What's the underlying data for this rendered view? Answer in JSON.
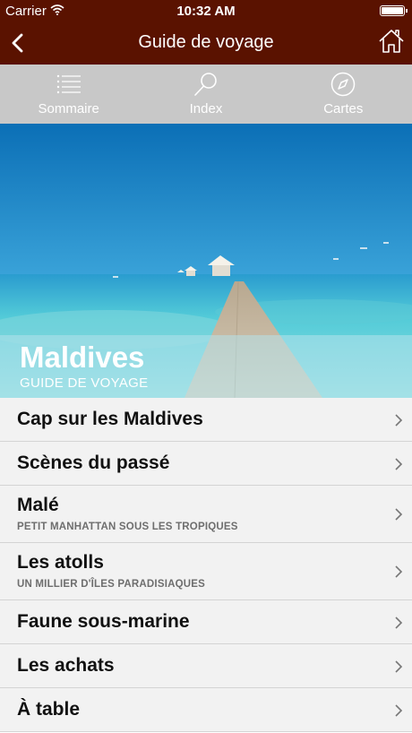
{
  "status_bar": {
    "carrier": "Carrier",
    "time": "10:32 AM"
  },
  "nav": {
    "title": "Guide de voyage",
    "back_icon": "chevron-left-icon",
    "home_icon": "home-icon"
  },
  "tabs": [
    {
      "label": "Sommaire",
      "icon": "list-icon"
    },
    {
      "label": "Index",
      "icon": "search-icon"
    },
    {
      "label": "Cartes",
      "icon": "compass-icon"
    }
  ],
  "hero": {
    "title": "Maldives",
    "subtitle": "GUIDE DE VOYAGE"
  },
  "chapters": [
    {
      "title": "Cap sur les Maldives",
      "subtitle": ""
    },
    {
      "title": "Scènes du passé",
      "subtitle": ""
    },
    {
      "title": "Malé",
      "subtitle": "PETIT MANHATTAN SOUS LES TROPIQUES"
    },
    {
      "title": "Les atolls",
      "subtitle": "UN MILLIER D'ÎLES PARADISIAQUES"
    },
    {
      "title": "Faune sous-marine",
      "subtitle": ""
    },
    {
      "title": "Les achats",
      "subtitle": ""
    },
    {
      "title": "À table",
      "subtitle": ""
    }
  ],
  "colors": {
    "nav_bar": "#5a1200",
    "toolbar": "#c8c8c8",
    "list_background": "#f2f2f2",
    "sea": "#3ec3d0",
    "sky": "#1a86c6"
  }
}
